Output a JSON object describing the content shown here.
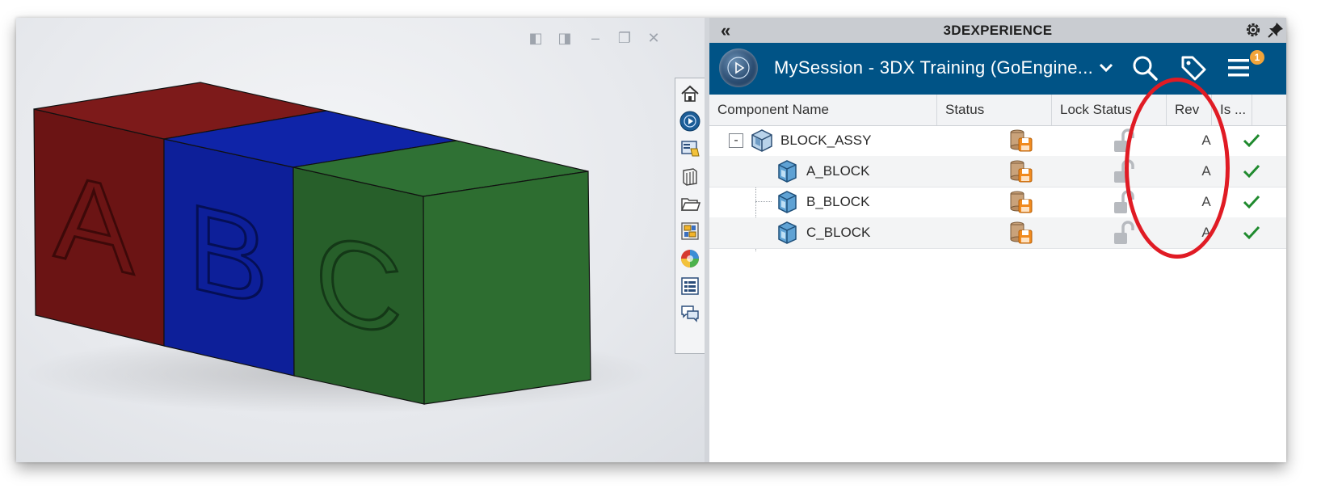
{
  "viewport": {
    "window_controls": [
      {
        "name": "prev-view-icon",
        "glyph": "◧"
      },
      {
        "name": "next-view-icon",
        "glyph": "◨"
      },
      {
        "name": "minimize-icon",
        "glyph": "–"
      },
      {
        "name": "restore-icon",
        "glyph": "❐"
      },
      {
        "name": "close-icon",
        "glyph": "✕"
      }
    ],
    "block_letters": [
      "A",
      "B",
      "C"
    ],
    "block_colors": {
      "a_front": "#6b1414",
      "a_top": "#7d1a1a",
      "b_front": "#0d1f99",
      "b_top": "#0f24a8",
      "c_front": "#275f2a",
      "c_side": "#2d6d30",
      "c_top": "#2f7134"
    }
  },
  "toolbar": {
    "items": [
      "home-icon",
      "3dexperience-icon",
      "design-library-icon",
      "file-explorer-icon",
      "folder-icon",
      "view-palette-icon",
      "appearances-icon",
      "custom-properties-icon",
      "forum-icon"
    ]
  },
  "panel": {
    "title": "3DEXPERIENCE",
    "collapse_glyph": "«",
    "session_name": "MySession - 3DX Training (GoEngine...",
    "notification_count": "1",
    "accent_color": "#005386",
    "columns": [
      "Component Name",
      "Status",
      "Lock Status",
      "Rev",
      "Is ..."
    ],
    "rows": [
      {
        "name": "BLOCK_ASSY",
        "rev": "A",
        "level": 0
      },
      {
        "name": "A_BLOCK",
        "rev": "A",
        "level": 1
      },
      {
        "name": "B_BLOCK",
        "rev": "A",
        "level": 1
      },
      {
        "name": "C_BLOCK",
        "rev": "A",
        "level": 1
      }
    ],
    "collapse_toggle": "-"
  },
  "annotation": {
    "highlight_color": "#e01b24"
  }
}
